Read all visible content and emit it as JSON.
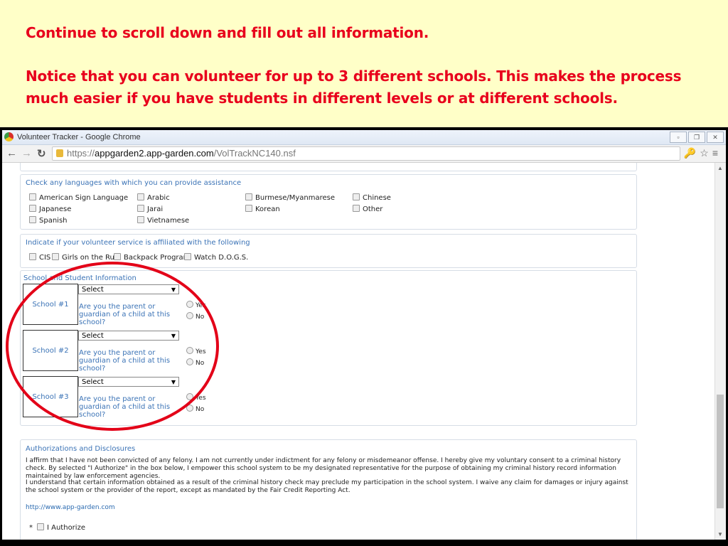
{
  "slide": {
    "line1": "Continue to scroll down and fill out all information.",
    "line2": "Notice that you can volunteer for up to 3 different schools.  This makes the process much easier if you have students in different levels or at different schools."
  },
  "browser": {
    "title": "Volunteer Tracker - Google Chrome",
    "url_scheme": "https://",
    "url_host": "appgarden2.app-garden.com",
    "url_path": "/VolTrackNC140.nsf"
  },
  "languages": {
    "heading": "Check any languages with which you can provide assistance",
    "items": [
      "American Sign Language",
      "Arabic",
      "Burmese/Myanmarese",
      "Chinese",
      "Japanese",
      "Jarai",
      "Korean",
      "Other",
      "Spanish",
      "Vietnamese"
    ]
  },
  "affiliation": {
    "heading": "Indicate if your volunteer service is affiliated with the following",
    "items": [
      "CIS",
      "Girls on the Run",
      "Backpack Program",
      "Watch D.O.G.S."
    ]
  },
  "schools": {
    "heading": "School and Student Information",
    "entries": [
      {
        "label": "School #1",
        "select": "Select",
        "question": "Are you the parent or guardian of a child at this school?",
        "yes": "Yes",
        "no": "No"
      },
      {
        "label": "School #2",
        "select": "Select",
        "question": "Are you the parent or guardian of a child at this school?",
        "yes": "Yes",
        "no": "No"
      },
      {
        "label": "School #3",
        "select": "Select",
        "question": "Are you the parent or guardian of a child at this school?",
        "yes": "Yes",
        "no": "No"
      }
    ]
  },
  "auth": {
    "heading": "Authorizations and Disclosures",
    "p1": "I affirm that I have not been convicted of any felony. I am not currently under indictment for any felony or misdemeanor offense. I hereby give my voluntary consent to a criminal history check. By selected \"I Authorize\" in the box below, I empower this school system to be my designated representative for the purpose of obtaining my criminal history record information maintained by law enforcement agencies.",
    "p2": "I understand that certain information obtained as a result of the criminal history check may preclude my participation in the school system. I waive any claim for damages or injury against the school system or the provider of the report, except as mandated by the Fair Credit Reporting Act.",
    "link": "http://www.app-garden.com",
    "required_mark": "*",
    "authorize_label": "I Authorize"
  },
  "colors": {
    "slide_bg": "#ffffc8",
    "slide_text": "#e8001c",
    "heading_blue": "#3b73b6",
    "annotation": "#e30018"
  }
}
